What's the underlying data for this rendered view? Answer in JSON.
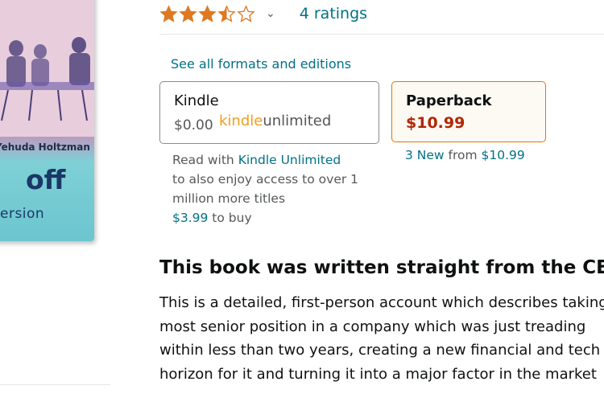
{
  "cover": {
    "author_text": "Yehuda Holtzman",
    "big_text": "off",
    "sub_text": "ersion"
  },
  "rating": {
    "stars_value": 3.5,
    "stars_max": 5,
    "ratings_text": "4 ratings",
    "star_color": "#de7921"
  },
  "formats": {
    "see_all_label": "See all formats and editions",
    "kindle": {
      "title": "Kindle",
      "price": "$0.00",
      "ku_logo_part1": "kindle",
      "ku_logo_part2": "unlimited",
      "read_with": "Read with ",
      "ku_link": "Kindle Unlimited",
      "line2": "to also enjoy access to over 1",
      "line3": "million more titles",
      "buy_price": "$3.99",
      "buy_suffix": " to buy"
    },
    "paperback": {
      "title": "Paperback",
      "price": "$10.99",
      "new_link": "3 New",
      "from_text": " from ",
      "from_price": "$10.99"
    }
  },
  "description": {
    "title": "This book was written straight from the CEO",
    "lines": [
      "This is a detailed, first-person account which describes taking",
      "most senior position in a company which was just treading",
      "within less than two years, creating a new financial and tech",
      "horizon for it and turning it into a major factor in the market"
    ]
  },
  "colors": {
    "link": "#007185",
    "price": "#b12704",
    "selected_border": "#e77600"
  }
}
